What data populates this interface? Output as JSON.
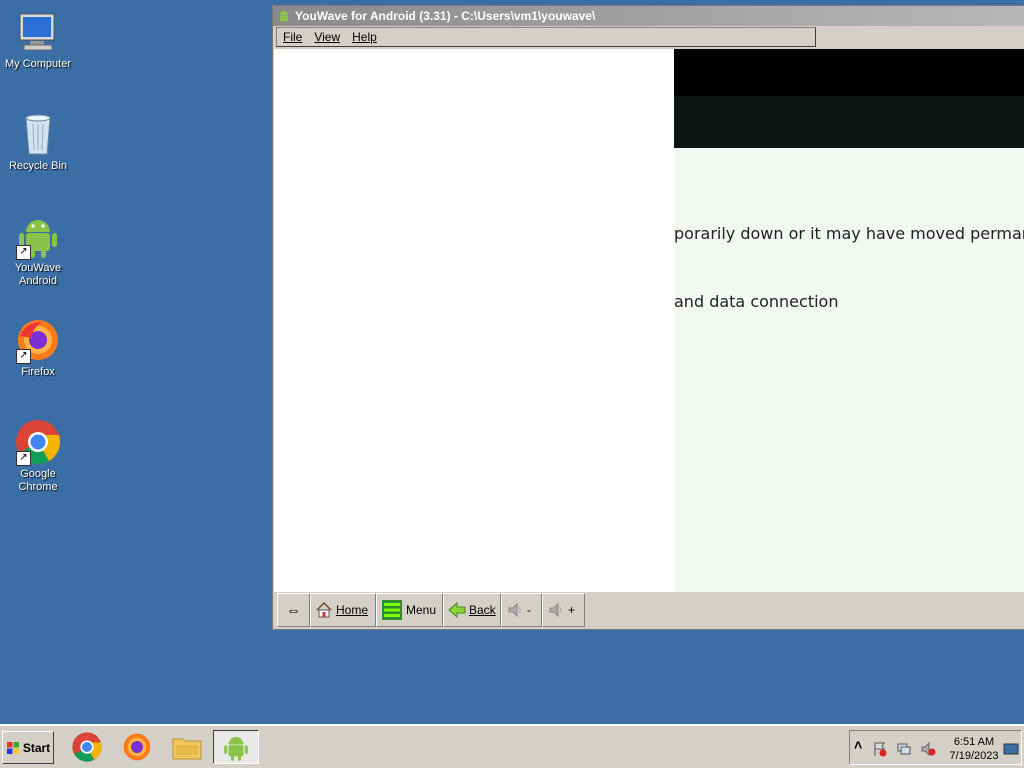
{
  "desktop": {
    "icons": [
      {
        "label": "My Computer"
      },
      {
        "label": "Recycle Bin"
      },
      {
        "label": "YouWave Android"
      },
      {
        "label": "Firefox"
      },
      {
        "label": "Google Chrome"
      }
    ]
  },
  "window": {
    "title": "YouWave for Android (3.31) - C:\\Users\\vm1\\youwave\\",
    "menu": [
      {
        "label": "File"
      },
      {
        "label": "View"
      },
      {
        "label": "Help"
      }
    ],
    "screen": {
      "line1": "porarily down or it may have moved permanently to",
      "line2": "and data connection"
    },
    "toolbar": {
      "resize_label": "⇔",
      "home": "Home",
      "menu": "Menu",
      "back": "Back",
      "vol_down": "-",
      "vol_up": "+"
    }
  },
  "taskbar": {
    "start": "Start",
    "time": "6:51 AM",
    "date": "7/19/2023",
    "tray_expand": "˄"
  },
  "colors": {
    "desktop_bg": "#3a6ea5",
    "android_green": "#8bc34a"
  }
}
